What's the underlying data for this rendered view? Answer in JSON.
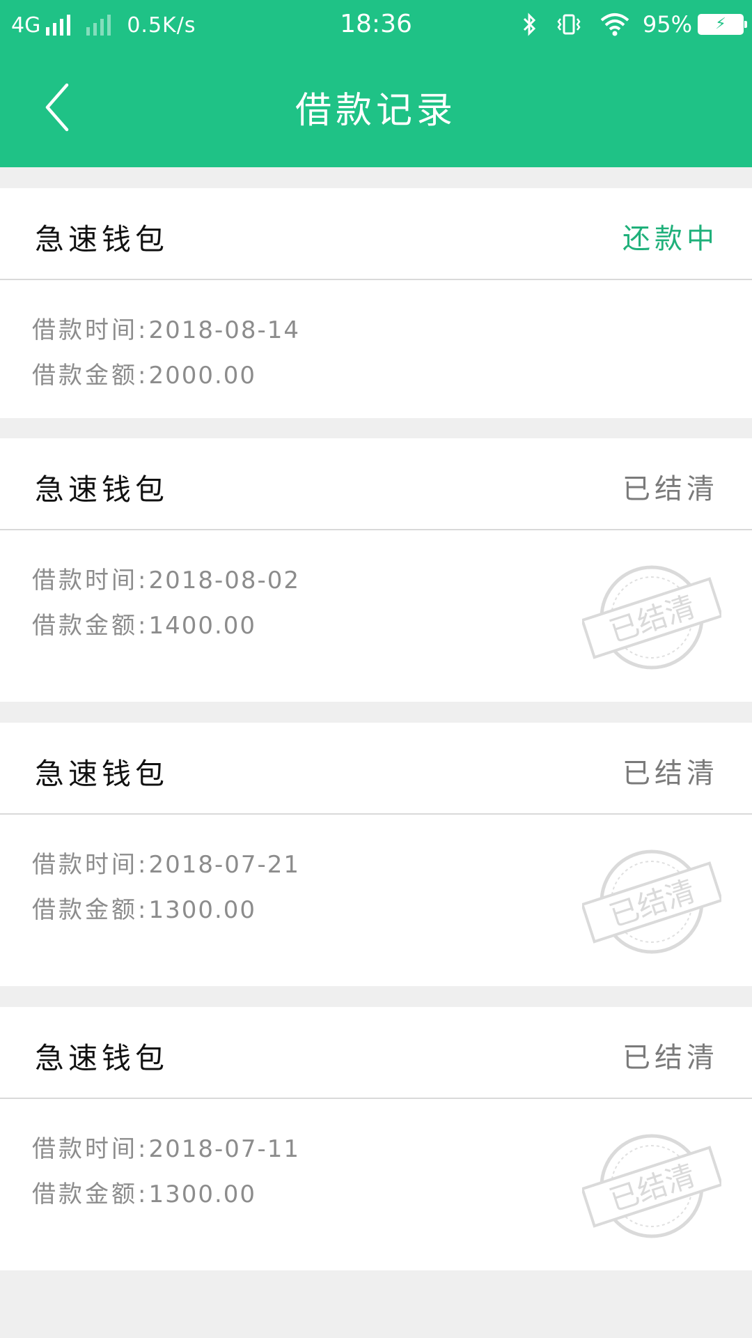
{
  "status_bar": {
    "network": "4G",
    "speed": "0.5K/s",
    "time": "18:36",
    "battery": "95%"
  },
  "header": {
    "title": "借款记录",
    "back_icon": "chevron-left-icon"
  },
  "colors": {
    "brand": "#1fc286",
    "status_active": "#1fb07a",
    "status_done": "#7a7a7a"
  },
  "labels": {
    "date_label": "借款时间:",
    "amount_label": "借款金额:",
    "stamp_text": "已结清"
  },
  "loans": [
    {
      "product": "急速钱包",
      "status": "还款中",
      "date": "2018-08-14",
      "amount": "2000.00",
      "settled": false
    },
    {
      "product": "急速钱包",
      "status": "已结清",
      "date": "2018-08-02",
      "amount": "1400.00",
      "settled": true
    },
    {
      "product": "急速钱包",
      "status": "已结清",
      "date": "2018-07-21",
      "amount": "1300.00",
      "settled": true
    },
    {
      "product": "急速钱包",
      "status": "已结清",
      "date": "2018-07-11",
      "amount": "1300.00",
      "settled": true
    }
  ]
}
